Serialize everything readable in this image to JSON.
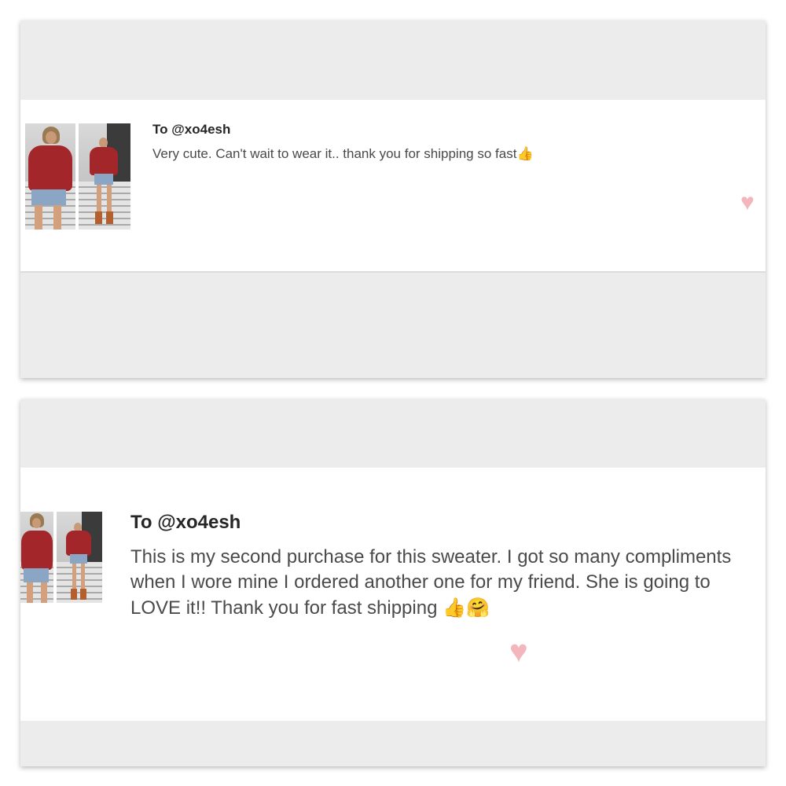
{
  "reviews": [
    {
      "to": "To @xo4esh",
      "message": "Very cute. Can't wait to wear it.. thank you for shipping so fast",
      "emojis": "👍",
      "heart_icon": "heart-icon",
      "heart_glyph": "♥"
    },
    {
      "to": "To @xo4esh",
      "message": "This is my second purchase for this sweater. I got so many compliments when I wore mine I ordered another one for my friend. She is going to LOVE it!! Thank you for fast shipping",
      "emojis": "👍🤗",
      "heart_icon": "heart-icon",
      "heart_glyph": "♥"
    }
  ],
  "colors": {
    "card_bg": "#ececec",
    "heart": "#f2b6bc",
    "sweater": "#a3262a"
  }
}
